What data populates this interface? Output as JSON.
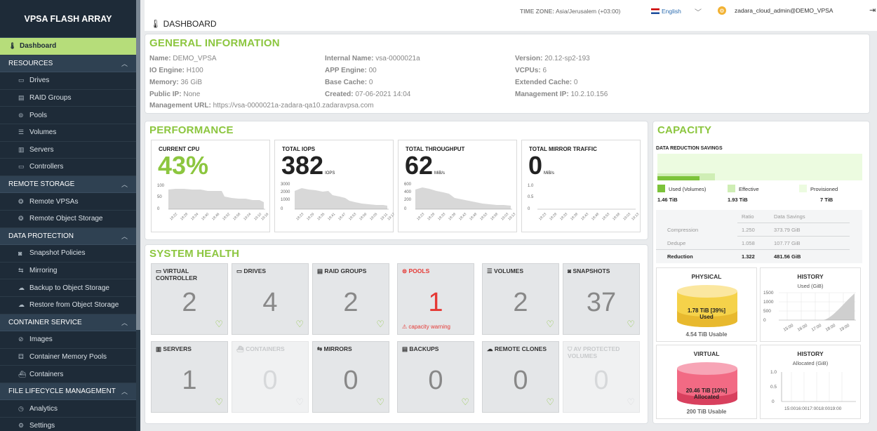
{
  "brand": "VPSA FLASH ARRAY",
  "nav": {
    "dashboard": "Dashboard",
    "resources": "RESOURCES",
    "drives": "Drives",
    "raid_groups": "RAID Groups",
    "pools": "Pools",
    "volumes": "Volumes",
    "servers": "Servers",
    "controllers": "Controllers",
    "remote_storage": "REMOTE STORAGE",
    "remote_vpsas": "Remote VPSAs",
    "remote_object_storage": "Remote Object Storage",
    "data_protection": "DATA PROTECTION",
    "snapshot_policies": "Snapshot Policies",
    "mirroring": "Mirroring",
    "backup_to_object_storage": "Backup to Object Storage",
    "restore_from_object_storage": "Restore from Object Storage",
    "container_service": "CONTAINER SERVICE",
    "images": "Images",
    "container_memory_pools": "Container Memory Pools",
    "containers": "Containers",
    "file_lifecycle": "FILE LIFECYCLE MANAGEMENT",
    "analytics": "Analytics",
    "settings": "Settings"
  },
  "topbar": {
    "title": "DASHBOARD",
    "timezone_label": "TIME ZONE:",
    "timezone_value": "Asia/Jerusalem (+03:00)",
    "language": "English",
    "user": "zadara_cloud_admin@DEMO_VPSA"
  },
  "general": {
    "title": "GENERAL INFORMATION",
    "name_label": "Name:",
    "name": "DEMO_VPSA",
    "io_engine_label": "IO Engine:",
    "io_engine": "H100",
    "memory_label": "Memory:",
    "memory": "36 GiB",
    "public_ip_label": "Public IP:",
    "public_ip": "None",
    "mgmt_url_label": "Management URL:",
    "mgmt_url": "https://vsa-0000021a-zadara-qa10.zadaravpsa.com",
    "internal_name_label": "Internal Name:",
    "internal_name": "vsa-0000021a",
    "app_engine_label": "APP Engine:",
    "app_engine": "00",
    "base_cache_label": "Base Cache:",
    "base_cache": "0",
    "created_label": "Created:",
    "created": "07-06-2021 14:04",
    "version_label": "Version:",
    "version": "20.12-sp2-193",
    "vcpus_label": "VCPUs:",
    "vcpus": "6",
    "ext_cache_label": "Extended Cache:",
    "ext_cache": "0",
    "mgmt_ip_label": "Management IP:",
    "mgmt_ip": "10.2.10.156"
  },
  "performance": {
    "title": "PERFORMANCE",
    "cpu": {
      "label": "CURRENT CPU",
      "value": "43%",
      "yticks": [
        "100",
        "50",
        "0"
      ]
    },
    "iops": {
      "label": "TOTAL IOPS",
      "value": "382",
      "unit": "IOPS",
      "yticks": [
        "3000",
        "2000",
        "1000",
        "0"
      ]
    },
    "throughput": {
      "label": "TOTAL THROUGHPUT",
      "value": "62",
      "unit": "MiB/s",
      "yticks": [
        "600",
        "400",
        "200",
        "0"
      ]
    },
    "mirror": {
      "label": "TOTAL MIRROR TRAFFIC",
      "value": "0",
      "unit": "MiB/s",
      "yticks": [
        "1.0",
        "0.5",
        "0"
      ]
    }
  },
  "health": {
    "title": "SYSTEM HEALTH",
    "virtual_controller": {
      "label": "VIRTUAL CONTROLLER",
      "count": "2"
    },
    "drives": {
      "label": "DRIVES",
      "count": "4"
    },
    "raid_groups": {
      "label": "RAID GROUPS",
      "count": "2"
    },
    "pools": {
      "label": "POOLS",
      "count": "1",
      "warning": "capacity warning"
    },
    "volumes": {
      "label": "VOLUMES",
      "count": "2"
    },
    "snapshots": {
      "label": "SNAPSHOTS",
      "count": "37"
    },
    "servers": {
      "label": "SERVERS",
      "count": "1"
    },
    "containers": {
      "label": "CONTAINERS",
      "count": "0"
    },
    "mirrors": {
      "label": "MIRRORS",
      "count": "0"
    },
    "backups": {
      "label": "BACKUPS",
      "count": "0"
    },
    "remote_clones": {
      "label": "REMOTE CLONES",
      "count": "0"
    },
    "av_protected": {
      "label": "AV PROTECTED VOLUMES",
      "count": "0"
    }
  },
  "capacity": {
    "title": "CAPACITY",
    "drs_title": "DATA REDUCTION SAVINGS",
    "used_label": "Used (Volumes)",
    "used_value": "1.46 TiB",
    "effective_label": "Effective",
    "effective_value": "1.93 TiB",
    "provisioned_label": "Provisioned",
    "provisioned_value": "7 TiB",
    "ratio_header": "Ratio",
    "savings_header": "Data Savings",
    "rows": [
      {
        "name": "Compression",
        "ratio": "1.250",
        "savings": "373.79 GiB"
      },
      {
        "name": "Dedupe",
        "ratio": "1.058",
        "savings": "107.77 GiB"
      },
      {
        "name": "Reduction",
        "ratio": "1.322",
        "savings": "481.56 GiB"
      }
    ],
    "physical": {
      "title": "PHYSICAL",
      "line1": "1.78 TiB [39%]",
      "line2": "Used",
      "usable": "4.54 TiB Usable"
    },
    "virtual": {
      "title": "VIRTUAL",
      "line1": "20.46 TiB [10%]",
      "line2": "Allocated",
      "usable": "200 TiB Usable"
    },
    "history_used": {
      "title": "HISTORY",
      "subtitle": "Used (GiB)",
      "yticks": [
        "1500",
        "1000",
        "500",
        "0"
      ],
      "xticks": [
        "15:00",
        "16:00",
        "17:00",
        "18:00",
        "19:00"
      ]
    },
    "history_alloc": {
      "title": "HISTORY",
      "subtitle": "Allocated (GiB)",
      "yticks": [
        "1.0",
        "0.5",
        "0"
      ],
      "xticks": "15:0016:0017:0018:0019:00"
    }
  },
  "colors": {
    "accent": "#8cc63f",
    "sidebar": "#1e2b38",
    "error": "#e53935"
  }
}
